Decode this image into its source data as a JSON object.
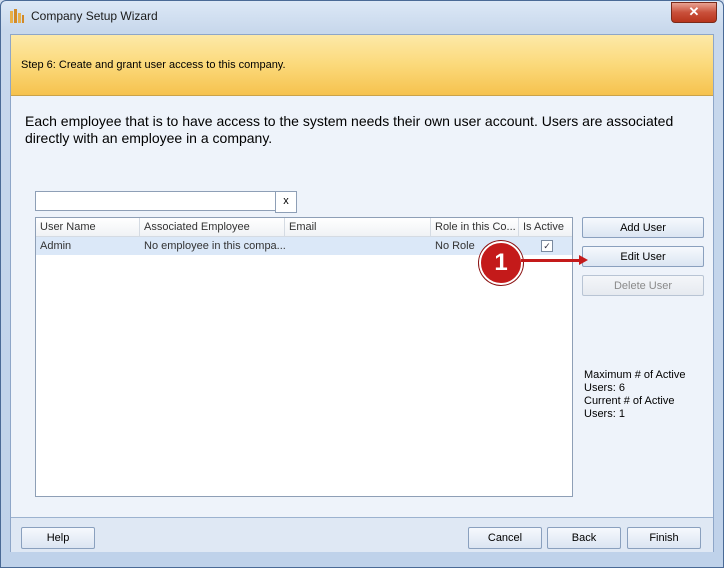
{
  "window": {
    "title": "Company Setup Wizard",
    "close_label": "✕"
  },
  "step": {
    "text": "Step 6: Create and grant user access to this company."
  },
  "description": "Each employee that is to have access to the system needs their own user account. Users are associated directly with an employee in a company.",
  "search": {
    "value": "",
    "clear_label": "x"
  },
  "grid": {
    "columns": [
      "User Name",
      "Associated Employee",
      "Email",
      "Role in this Co...",
      "Is Active"
    ],
    "rows": [
      {
        "user_name": "Admin",
        "employee": "No employee in this compa...",
        "email": "",
        "role": "No Role",
        "is_active": "✓"
      }
    ]
  },
  "side_buttons": {
    "add": "Add User",
    "edit": "Edit User",
    "delete": "Delete User"
  },
  "info": {
    "max_label": "Maximum # of Active Users: 6",
    "current_label": "Current # of Active Users: 1"
  },
  "footer": {
    "help": "Help",
    "cancel": "Cancel",
    "back": "Back",
    "finish": "Finish"
  },
  "annotation": {
    "marker": "1"
  },
  "colors": {
    "banner": "#fbd97a",
    "marker": "#c41a1a",
    "selected_row": "#dbe8f8"
  }
}
